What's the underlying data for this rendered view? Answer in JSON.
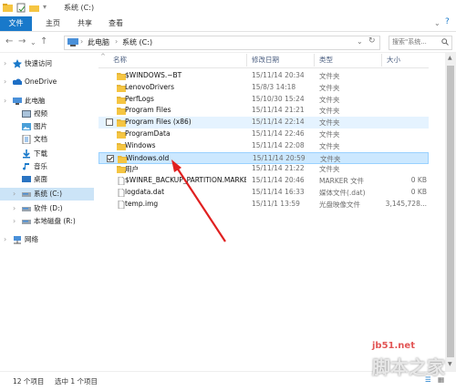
{
  "window": {
    "title": "系统 (C:)"
  },
  "ribbon": {
    "tabs": [
      "文件",
      "主页",
      "共享",
      "查看"
    ]
  },
  "address": {
    "crumbs": [
      "此电脑",
      "系统 (C:)"
    ],
    "search_placeholder": "搜索\"系统...",
    "crumb_sep": "›"
  },
  "nav": {
    "items": [
      {
        "label": "快速访问",
        "icon": "star-icon",
        "indent": 0,
        "selected": false
      },
      {
        "label": "OneDrive",
        "icon": "onedrive-icon",
        "indent": 0,
        "selected": false
      },
      {
        "label": "此电脑",
        "icon": "computer-icon",
        "indent": 0,
        "selected": false
      },
      {
        "label": "视频",
        "icon": "video-icon",
        "indent": 1,
        "selected": false
      },
      {
        "label": "图片",
        "icon": "picture-icon",
        "indent": 1,
        "selected": false
      },
      {
        "label": "文档",
        "icon": "document-icon",
        "indent": 1,
        "selected": false
      },
      {
        "label": "下载",
        "icon": "download-icon",
        "indent": 1,
        "selected": false
      },
      {
        "label": "音乐",
        "icon": "music-icon",
        "indent": 1,
        "selected": false
      },
      {
        "label": "桌面",
        "icon": "desktop-icon",
        "indent": 1,
        "selected": false
      },
      {
        "label": "系统 (C:)",
        "icon": "drive-icon",
        "indent": 1,
        "selected": true
      },
      {
        "label": "软件 (D:)",
        "icon": "drive-icon",
        "indent": 1,
        "selected": false
      },
      {
        "label": "本地磁盘 (R:)",
        "icon": "drive-icon",
        "indent": 1,
        "selected": false
      },
      {
        "label": "网络",
        "icon": "network-icon",
        "indent": 0,
        "selected": false
      }
    ]
  },
  "columns": {
    "name": "名称",
    "date": "修改日期",
    "type": "类型",
    "size": "大小"
  },
  "files": [
    {
      "name": "$WINDOWS.~BT",
      "date": "15/11/14 20:34",
      "type": "文件夹",
      "size": "",
      "kind": "folder",
      "state": ""
    },
    {
      "name": "LenovoDrivers",
      "date": "15/8/3 14:18",
      "type": "文件夹",
      "size": "",
      "kind": "folder",
      "state": ""
    },
    {
      "name": "PerfLogs",
      "date": "15/10/30 15:24",
      "type": "文件夹",
      "size": "",
      "kind": "folder",
      "state": ""
    },
    {
      "name": "Program Files",
      "date": "15/11/14 21:21",
      "type": "文件夹",
      "size": "",
      "kind": "folder",
      "state": ""
    },
    {
      "name": "Program Files (x86)",
      "date": "15/11/14 22:14",
      "type": "文件夹",
      "size": "",
      "kind": "folder",
      "state": "hover"
    },
    {
      "name": "ProgramData",
      "date": "15/11/14 22:46",
      "type": "文件夹",
      "size": "",
      "kind": "folder",
      "state": ""
    },
    {
      "name": "Windows",
      "date": "15/11/14 22:08",
      "type": "文件夹",
      "size": "",
      "kind": "folder",
      "state": ""
    },
    {
      "name": "Windows.old",
      "date": "15/11/14 20:59",
      "type": "文件夹",
      "size": "",
      "kind": "folder",
      "state": "selected"
    },
    {
      "name": "用户",
      "date": "15/11/14 21:22",
      "type": "文件夹",
      "size": "",
      "kind": "folder",
      "state": ""
    },
    {
      "name": "$WINRE_BACKUP_PARTITION.MARKER",
      "date": "15/11/14 20:46",
      "type": "MARKER 文件",
      "size": "0 KB",
      "kind": "file",
      "state": ""
    },
    {
      "name": "logdata.dat",
      "date": "15/11/14 16:33",
      "type": "媒体文件(.dat)",
      "size": "0 KB",
      "kind": "file",
      "state": ""
    },
    {
      "name": "temp.img",
      "date": "15/11/1 13:59",
      "type": "光盘映像文件",
      "size": "3,145,728...",
      "kind": "file",
      "state": ""
    }
  ],
  "status": {
    "count": "12 个项目",
    "selected": "选中 1 个项目"
  },
  "watermark": {
    "line1": "jb51.net",
    "line2": "脚本之家"
  },
  "colors": {
    "accent": "#1979ca",
    "folder": "#f5c542",
    "selection": "#cce8ff",
    "arrow": "#e02020"
  }
}
